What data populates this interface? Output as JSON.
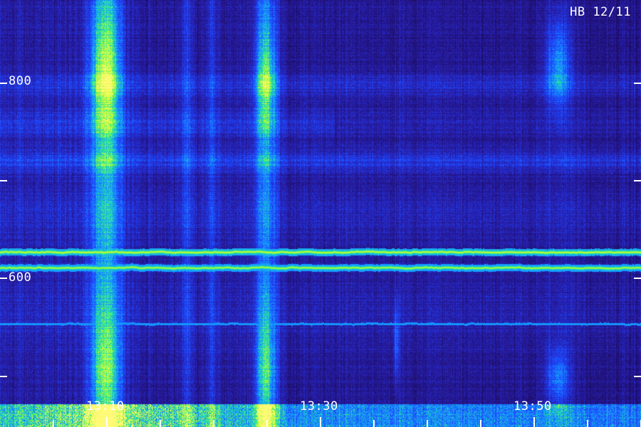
{
  "title": "HB 12/11",
  "y_axis": {
    "labels": [
      "800",
      "600"
    ]
  },
  "x_axis": {
    "labels": [
      "13:10",
      "13:30",
      "13:50"
    ]
  },
  "colors": {
    "background": "#0b0530",
    "trace_core": "#f4ee2a",
    "trace_halo": "#2ef08a",
    "band_blue": "#1a3cff",
    "text": "#ffffff"
  }
}
